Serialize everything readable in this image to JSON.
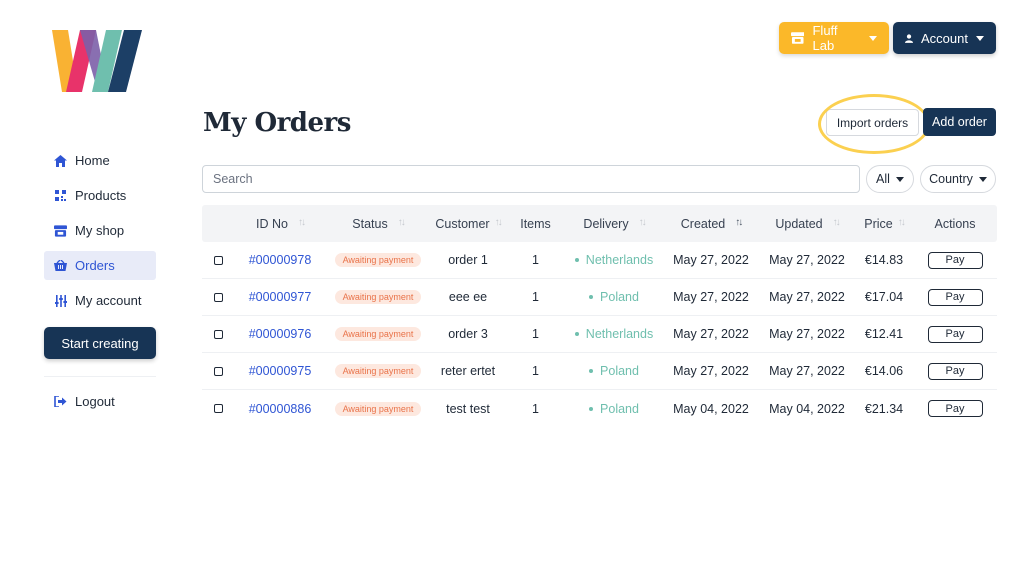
{
  "brand": {
    "colors": [
      "#f9b233",
      "#e8336a",
      "#7c5fa8",
      "#6fbfae",
      "#1c3f66"
    ]
  },
  "header": {
    "shop_label": "Fluff Lab",
    "account_label": "Account"
  },
  "sidebar": {
    "items": [
      {
        "label": "Home",
        "icon": "home-icon",
        "active": false
      },
      {
        "label": "Products",
        "icon": "qr-icon",
        "active": false
      },
      {
        "label": "My shop",
        "icon": "store-icon",
        "active": false
      },
      {
        "label": "Orders",
        "icon": "basket-icon",
        "active": true
      },
      {
        "label": "My account",
        "icon": "sliders-icon",
        "active": false
      }
    ],
    "start_label": "Start creating",
    "logout_label": "Logout"
  },
  "main": {
    "title": "My Orders",
    "import_label": "Import orders",
    "add_label": "Add order",
    "search_placeholder": "Search",
    "filter_all": "All",
    "filter_country": "Country"
  },
  "table": {
    "headers": [
      "ID No",
      "Status",
      "Customer",
      "Items",
      "Delivery",
      "Created",
      "Updated",
      "Price",
      "Actions"
    ],
    "rows": [
      {
        "id": "#00000978",
        "status": "Awaiting payment",
        "customer": "order 1",
        "items": "1",
        "delivery": "Netherlands",
        "created": "May 27, 2022",
        "updated": "May 27, 2022",
        "price": "€14.83",
        "action": "Pay"
      },
      {
        "id": "#00000977",
        "status": "Awaiting payment",
        "customer": "eee ee",
        "items": "1",
        "delivery": "Poland",
        "created": "May 27, 2022",
        "updated": "May 27, 2022",
        "price": "€17.04",
        "action": "Pay"
      },
      {
        "id": "#00000976",
        "status": "Awaiting payment",
        "customer": "order 3",
        "items": "1",
        "delivery": "Netherlands",
        "created": "May 27, 2022",
        "updated": "May 27, 2022",
        "price": "€12.41",
        "action": "Pay"
      },
      {
        "id": "#00000975",
        "status": "Awaiting payment",
        "customer": "reter ertet",
        "items": "1",
        "delivery": "Poland",
        "created": "May 27, 2022",
        "updated": "May 27, 2022",
        "price": "€14.06",
        "action": "Pay"
      },
      {
        "id": "#00000886",
        "status": "Awaiting payment",
        "customer": "test test",
        "items": "1",
        "delivery": "Poland",
        "created": "May 04, 2022",
        "updated": "May 04, 2022",
        "price": "€21.34",
        "action": "Pay"
      }
    ]
  }
}
